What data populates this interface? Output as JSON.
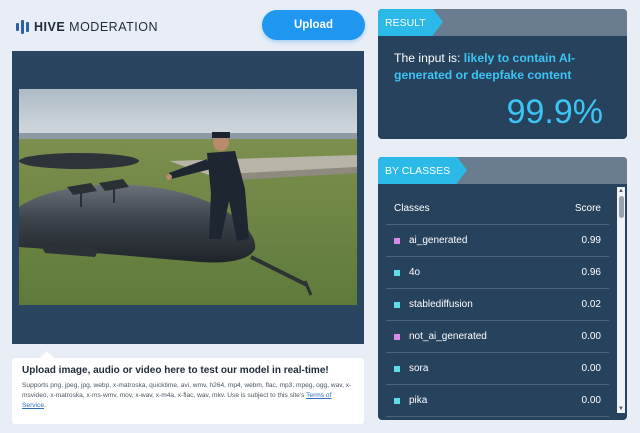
{
  "header": {
    "logo_bold": "HIVE",
    "logo_rest": "MODERATION",
    "upload_label": "Upload"
  },
  "media": {
    "caption_title": "Upload image, audio or video here to test our model in real-time!",
    "caption_body": "Supports png, jpeg, jpg, webp, x-matroska, quicktime, avi, wmv, h264, mp4, webm, flac, mp3, mpeg, ogg, wav, x-msvideo, x-matroska, x-ms-wmv, mov, x-wav, x-m4a, x-flac, wav, mkv. Use is subject to this site's",
    "terms_link": "Terms of Service",
    "terms_suffix": "."
  },
  "result": {
    "tag": "RESULT",
    "prefix": "The input is: ",
    "verdict": "likely to contain AI-generated or deepfake content",
    "score": "99.9%"
  },
  "classes": {
    "tag": "BY CLASSES",
    "col_class": "Classes",
    "col_score": "Score",
    "rows": [
      {
        "name": "ai_generated",
        "score": "0.99",
        "color": "#d98be8"
      },
      {
        "name": "4o",
        "score": "0.96",
        "color": "#5fdde8"
      },
      {
        "name": "stablediffusion",
        "score": "0.02",
        "color": "#5fdde8"
      },
      {
        "name": "not_ai_generated",
        "score": "0.00",
        "color": "#d98be8"
      },
      {
        "name": "sora",
        "score": "0.00",
        "color": "#5fdde8"
      },
      {
        "name": "pika",
        "score": "0.00",
        "color": "#5fdde8"
      }
    ]
  }
}
